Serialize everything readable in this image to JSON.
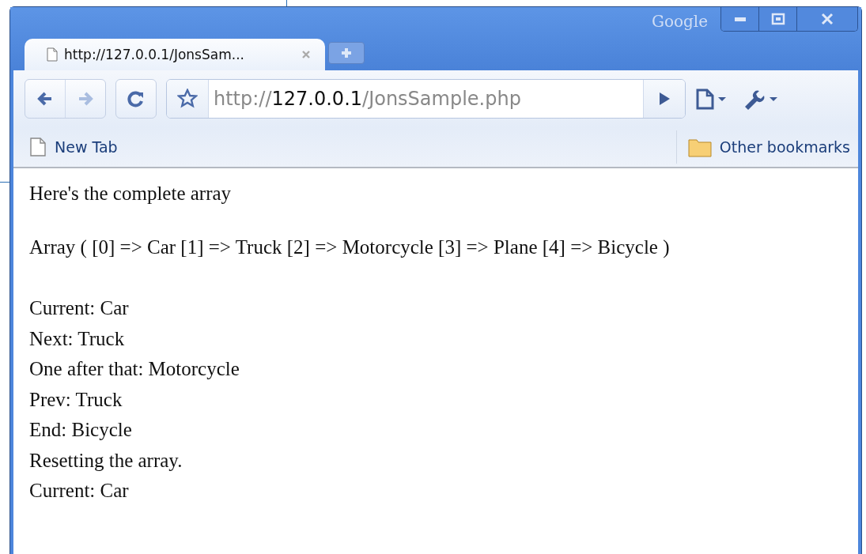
{
  "window": {
    "brand": "Google"
  },
  "tabs": [
    {
      "title": "http://127.0.0.1/JonsSam...",
      "selected": true
    }
  ],
  "address": {
    "scheme": "http://",
    "host": "127.0.0.1",
    "path": "/JonsSample.php"
  },
  "bookmarks": [
    {
      "kind": "page",
      "label": "New Tab"
    }
  ],
  "other_bookmarks": {
    "label": "Other bookmarks"
  },
  "content": {
    "paragraphs": [
      "Here's the complete array",
      "Array ( [0] => Car [1] => Truck [2] => Motorcycle [3] => Plane [4] => Bicycle )"
    ],
    "lines": [
      "Current: Car",
      "Next: Truck",
      "One after that: Motorcycle",
      "Prev: Truck",
      "End: Bicycle",
      "Resetting the array.",
      "Current: Car"
    ]
  }
}
